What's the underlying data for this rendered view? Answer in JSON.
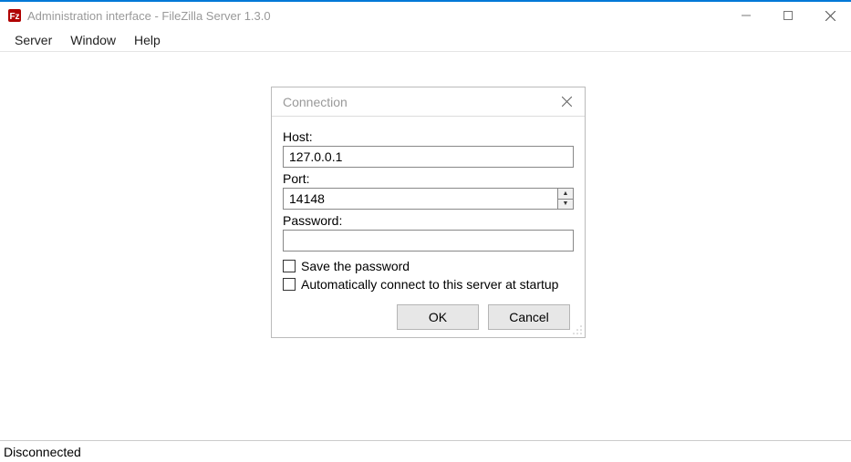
{
  "window": {
    "title": "Administration interface - FileZilla Server 1.3.0"
  },
  "menu": {
    "server": "Server",
    "window": "Window",
    "help": "Help"
  },
  "dialog": {
    "title": "Connection",
    "host_label": "Host:",
    "host_value": "127.0.0.1",
    "port_label": "Port:",
    "port_value": "14148",
    "password_label": "Password:",
    "password_value": "",
    "save_password_label": "Save the password",
    "auto_connect_label": "Automatically connect to this server at startup",
    "ok_label": "OK",
    "cancel_label": "Cancel"
  },
  "status": {
    "text": "Disconnected"
  }
}
